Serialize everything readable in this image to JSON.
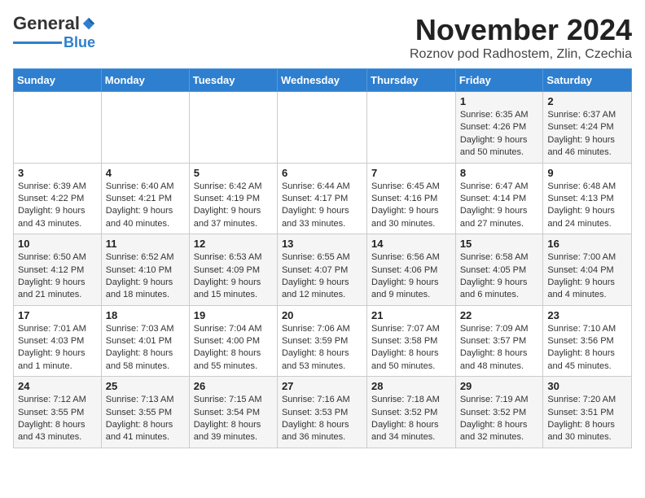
{
  "header": {
    "logo_general": "General",
    "logo_blue": "Blue",
    "title": "November 2024",
    "subtitle": "Roznov pod Radhostem, Zlin, Czechia"
  },
  "days_of_week": [
    "Sunday",
    "Monday",
    "Tuesday",
    "Wednesday",
    "Thursday",
    "Friday",
    "Saturday"
  ],
  "weeks": [
    [
      {
        "day": "",
        "info": ""
      },
      {
        "day": "",
        "info": ""
      },
      {
        "day": "",
        "info": ""
      },
      {
        "day": "",
        "info": ""
      },
      {
        "day": "",
        "info": ""
      },
      {
        "day": "1",
        "info": "Sunrise: 6:35 AM\nSunset: 4:26 PM\nDaylight: 9 hours and 50 minutes."
      },
      {
        "day": "2",
        "info": "Sunrise: 6:37 AM\nSunset: 4:24 PM\nDaylight: 9 hours and 46 minutes."
      }
    ],
    [
      {
        "day": "3",
        "info": "Sunrise: 6:39 AM\nSunset: 4:22 PM\nDaylight: 9 hours and 43 minutes."
      },
      {
        "day": "4",
        "info": "Sunrise: 6:40 AM\nSunset: 4:21 PM\nDaylight: 9 hours and 40 minutes."
      },
      {
        "day": "5",
        "info": "Sunrise: 6:42 AM\nSunset: 4:19 PM\nDaylight: 9 hours and 37 minutes."
      },
      {
        "day": "6",
        "info": "Sunrise: 6:44 AM\nSunset: 4:17 PM\nDaylight: 9 hours and 33 minutes."
      },
      {
        "day": "7",
        "info": "Sunrise: 6:45 AM\nSunset: 4:16 PM\nDaylight: 9 hours and 30 minutes."
      },
      {
        "day": "8",
        "info": "Sunrise: 6:47 AM\nSunset: 4:14 PM\nDaylight: 9 hours and 27 minutes."
      },
      {
        "day": "9",
        "info": "Sunrise: 6:48 AM\nSunset: 4:13 PM\nDaylight: 9 hours and 24 minutes."
      }
    ],
    [
      {
        "day": "10",
        "info": "Sunrise: 6:50 AM\nSunset: 4:12 PM\nDaylight: 9 hours and 21 minutes."
      },
      {
        "day": "11",
        "info": "Sunrise: 6:52 AM\nSunset: 4:10 PM\nDaylight: 9 hours and 18 minutes."
      },
      {
        "day": "12",
        "info": "Sunrise: 6:53 AM\nSunset: 4:09 PM\nDaylight: 9 hours and 15 minutes."
      },
      {
        "day": "13",
        "info": "Sunrise: 6:55 AM\nSunset: 4:07 PM\nDaylight: 9 hours and 12 minutes."
      },
      {
        "day": "14",
        "info": "Sunrise: 6:56 AM\nSunset: 4:06 PM\nDaylight: 9 hours and 9 minutes."
      },
      {
        "day": "15",
        "info": "Sunrise: 6:58 AM\nSunset: 4:05 PM\nDaylight: 9 hours and 6 minutes."
      },
      {
        "day": "16",
        "info": "Sunrise: 7:00 AM\nSunset: 4:04 PM\nDaylight: 9 hours and 4 minutes."
      }
    ],
    [
      {
        "day": "17",
        "info": "Sunrise: 7:01 AM\nSunset: 4:03 PM\nDaylight: 9 hours and 1 minute."
      },
      {
        "day": "18",
        "info": "Sunrise: 7:03 AM\nSunset: 4:01 PM\nDaylight: 8 hours and 58 minutes."
      },
      {
        "day": "19",
        "info": "Sunrise: 7:04 AM\nSunset: 4:00 PM\nDaylight: 8 hours and 55 minutes."
      },
      {
        "day": "20",
        "info": "Sunrise: 7:06 AM\nSunset: 3:59 PM\nDaylight: 8 hours and 53 minutes."
      },
      {
        "day": "21",
        "info": "Sunrise: 7:07 AM\nSunset: 3:58 PM\nDaylight: 8 hours and 50 minutes."
      },
      {
        "day": "22",
        "info": "Sunrise: 7:09 AM\nSunset: 3:57 PM\nDaylight: 8 hours and 48 minutes."
      },
      {
        "day": "23",
        "info": "Sunrise: 7:10 AM\nSunset: 3:56 PM\nDaylight: 8 hours and 45 minutes."
      }
    ],
    [
      {
        "day": "24",
        "info": "Sunrise: 7:12 AM\nSunset: 3:55 PM\nDaylight: 8 hours and 43 minutes."
      },
      {
        "day": "25",
        "info": "Sunrise: 7:13 AM\nSunset: 3:55 PM\nDaylight: 8 hours and 41 minutes."
      },
      {
        "day": "26",
        "info": "Sunrise: 7:15 AM\nSunset: 3:54 PM\nDaylight: 8 hours and 39 minutes."
      },
      {
        "day": "27",
        "info": "Sunrise: 7:16 AM\nSunset: 3:53 PM\nDaylight: 8 hours and 36 minutes."
      },
      {
        "day": "28",
        "info": "Sunrise: 7:18 AM\nSunset: 3:52 PM\nDaylight: 8 hours and 34 minutes."
      },
      {
        "day": "29",
        "info": "Sunrise: 7:19 AM\nSunset: 3:52 PM\nDaylight: 8 hours and 32 minutes."
      },
      {
        "day": "30",
        "info": "Sunrise: 7:20 AM\nSunset: 3:51 PM\nDaylight: 8 hours and 30 minutes."
      }
    ]
  ]
}
